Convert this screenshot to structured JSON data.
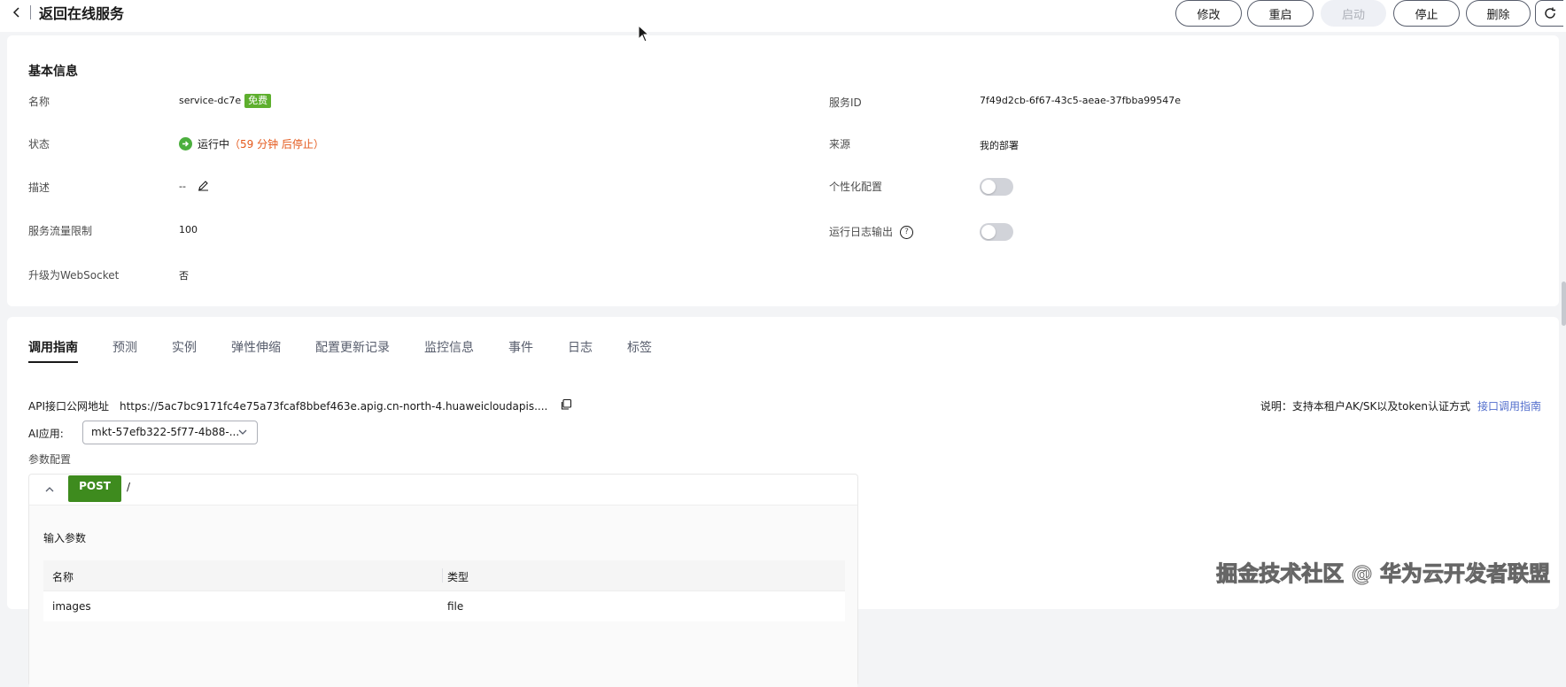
{
  "header": {
    "back_title": "返回在线服务",
    "buttons": {
      "modify": "修改",
      "restart": "重启",
      "start": "启动",
      "stop": "停止",
      "delete": "删除"
    }
  },
  "basic_info": {
    "title": "基本信息",
    "name_label": "名称",
    "name_value": "service-dc7e",
    "name_tag": "免费",
    "status_label": "状态",
    "status_value": "运行中",
    "status_countdown": "（59 分钟 后停止）",
    "description_label": "描述",
    "description_value": "--",
    "traffic_limit_label": "服务流量限制",
    "traffic_limit_value": "100",
    "websocket_label": "升级为WebSocket",
    "websocket_value": "否",
    "service_id_label": "服务ID",
    "service_id_value": "7f49d2cb-6f67-43c5-aeae-37fbba99547e",
    "source_label": "来源",
    "source_value": "我的部署",
    "personalized_label": "个性化配置",
    "personalized_enabled": false,
    "log_output_label": "运行日志输出",
    "log_output_enabled": false
  },
  "tabs": [
    {
      "label": "调用指南",
      "active": true
    },
    {
      "label": "预测",
      "active": false
    },
    {
      "label": "实例",
      "active": false
    },
    {
      "label": "弹性伸缩",
      "active": false
    },
    {
      "label": "配置更新记录",
      "active": false
    },
    {
      "label": "监控信息",
      "active": false
    },
    {
      "label": "事件",
      "active": false
    },
    {
      "label": "日志",
      "active": false
    },
    {
      "label": "标签",
      "active": false
    }
  ],
  "guide": {
    "api_label": "API接口公网地址",
    "api_url": "https://5ac7bc9171fc4e75a73fcaf8bbef463e.apig.cn-north-4.huaweicloudapis....",
    "note_text": "说明：支持本租户AK/SK以及token认证方式",
    "note_link": "接口调用指南",
    "ai_app_label": "AI应用:",
    "ai_app_value": "mkt-57efb322-5f77-4b88-...",
    "param_config_label": "参数配置",
    "method": "POST",
    "path": "/",
    "input_params_label": "输入参数",
    "table_headers": [
      "名称",
      "类型"
    ],
    "table_rows": [
      [
        "images",
        "file"
      ]
    ]
  },
  "watermark": "掘金技术社区 @ 华为云开发者联盟",
  "colors": {
    "status_green": "#4caf3e",
    "free_tag": "#5eaf2e",
    "post_badge": "#3e8b1e",
    "countdown": "#e4591c",
    "link": "#526ecc"
  }
}
